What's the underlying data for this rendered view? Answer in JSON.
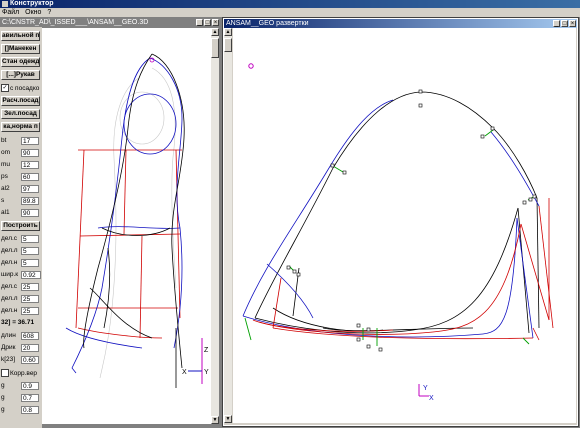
{
  "app": {
    "title": "Конструктор"
  },
  "menu": [
    "Файл",
    "Окно",
    "?"
  ],
  "window_left": {
    "title": "C:\\CNSTR_AD\\_ISSED___\\ANSAM__GEO.3D"
  },
  "window_right": {
    "title": "ANSAM__GEO развертки"
  },
  "panel": {
    "buttons": [
      "авильной по",
      "[]Манекен",
      "Стан одежд",
      "[...]Рукав"
    ],
    "check_posadka": {
      "label": "с посадко",
      "checked": true
    },
    "buttons2": [
      "Расч.посад",
      "Зел.посад",
      "ка,норма п"
    ],
    "params": [
      {
        "label": "bt",
        "value": "17"
      },
      {
        "label": "om",
        "value": "90"
      },
      {
        "label": "mu",
        "value": "12"
      },
      {
        "label": "ps",
        "value": "60"
      },
      {
        "label": "al2",
        "value": "97"
      },
      {
        "label": "s",
        "value": "89.8"
      },
      {
        "label": "al1",
        "value": "90"
      }
    ],
    "build_button": "Построить",
    "params2": [
      {
        "label": "дел.с",
        "value": "5"
      },
      {
        "label": "дел.л",
        "value": "5"
      },
      {
        "label": "дел.н",
        "value": "5"
      },
      {
        "label": "шир.к",
        "value": "0.92"
      },
      {
        "label": "дел.с",
        "value": "25"
      },
      {
        "label": "дел.л",
        "value": "25"
      },
      {
        "label": "дел.н",
        "value": "25"
      }
    ],
    "result_text": "32] = 36.71",
    "params3": [
      {
        "label": "длин",
        "value": "608"
      },
      {
        "label": "Дрик",
        "value": "20"
      },
      {
        "label": "k[23]",
        "value": "0.60"
      }
    ],
    "check_korr": {
      "label": "Корр.вер",
      "checked": false
    },
    "params4": [
      {
        "label": "g",
        "value": "0.9"
      },
      {
        "label": "g",
        "value": "0.7"
      },
      {
        "label": "g",
        "value": "0.8"
      }
    ]
  },
  "axes_left": {
    "z": "Z",
    "x": "X",
    "y": "Y"
  },
  "axes_right": {
    "y": "Y",
    "x": "X"
  },
  "colors": {
    "black": "#000000",
    "red": "#d00000",
    "blue": "#1010c0",
    "green": "#00a000",
    "magenta": "#c000c0"
  }
}
